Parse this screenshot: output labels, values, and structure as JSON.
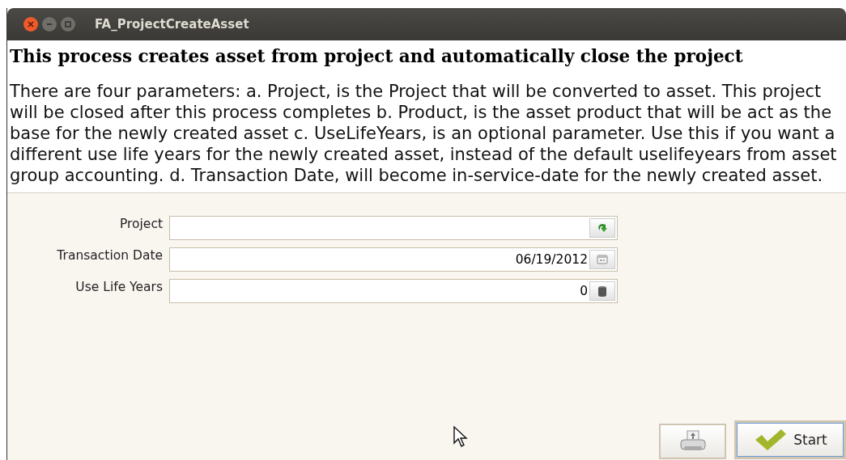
{
  "window": {
    "title": "FA_ProjectCreateAsset"
  },
  "heading": "This process creates asset from project and automatically close the project",
  "description": "There are four parameters: a. Project, is the Project that will be converted to asset. This project will be closed after this process completes b. Product, is the asset product that will be act as the base for the newly created asset c. UseLifeYears, is an optional parameter. Use this if you want a different use life years for the newly created asset, instead of the default uselifeyears from asset group accounting. d. Transaction Date, will become in-service-date for the newly created asset.",
  "parameters": [
    {
      "label": "Project",
      "kind": "lookup"
    },
    {
      "label": "Transaction Date",
      "kind": "date",
      "value": "06/19/2012"
    },
    {
      "label": "Use Life Years",
      "kind": "number",
      "value": "0"
    }
  ],
  "buttons": [
    {
      "kind": "print"
    },
    {
      "kind": "start",
      "label": "Start",
      "focused": true
    }
  ]
}
